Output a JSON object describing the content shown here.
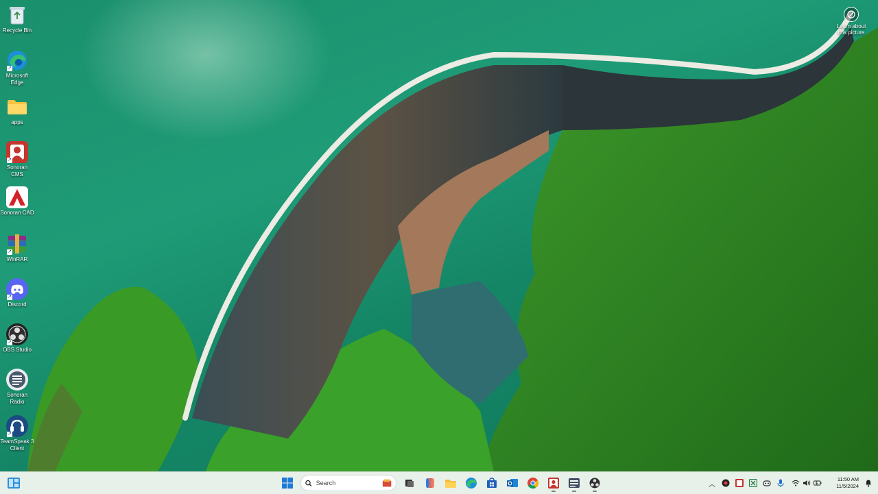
{
  "desktop": {
    "icons": [
      {
        "label": "Recycle Bin",
        "icon": "recycle-bin-icon"
      },
      {
        "label": "Microsoft Edge",
        "icon": "edge-icon"
      },
      {
        "label": "apps",
        "icon": "folder-icon"
      },
      {
        "label": "Sonoran CMS",
        "icon": "sonoran-cms-icon"
      },
      {
        "label": "Sonoran CAD",
        "icon": "sonoran-cad-icon"
      },
      {
        "label": "WinRAR",
        "icon": "winrar-icon"
      },
      {
        "label": "Discord",
        "icon": "discord-icon"
      },
      {
        "label": "OBS Studio",
        "icon": "obs-studio-icon"
      },
      {
        "label": "Sonoran Radio",
        "icon": "sonoran-radio-icon"
      },
      {
        "label": "TeamSpeak 3 Client",
        "icon": "teamspeak-icon"
      }
    ],
    "learn_about": {
      "label": "Learn about this picture",
      "icon": "camera-icon"
    }
  },
  "taskbar": {
    "search_placeholder": "Search",
    "pinned": [
      "start-icon",
      "search-icon",
      "task-view-icon",
      "copilot-icon",
      "file-explorer-icon",
      "edge-icon",
      "microsoft-store-icon",
      "outlook-icon",
      "chrome-icon",
      "sonoran-cms-icon",
      "sonoran-radio-icon",
      "obs-studio-icon"
    ],
    "tray": {
      "time": "11:50 AM",
      "date": "11/5/2024"
    }
  },
  "colors": {
    "lake": "#1a8f6c",
    "taskbar_bg": "#e8f0ea",
    "forest": "#2f7d1f"
  }
}
